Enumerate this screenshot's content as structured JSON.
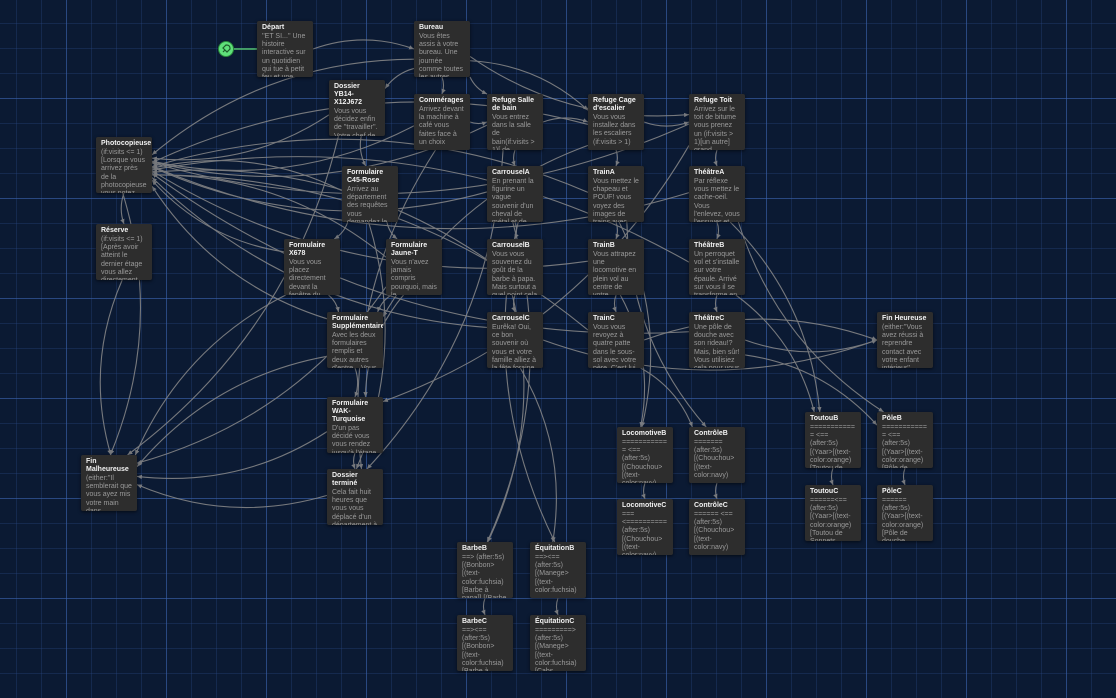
{
  "story": {
    "start_icon": "rocket-icon",
    "accent_color": "#5fe07a",
    "passages": [
      {
        "id": "depart",
        "title": "Départ",
        "excerpt": "''ET SI...'' Une histoire interactive sur un quotidien qui tue à petit feu et une"
      },
      {
        "id": "bureau",
        "title": "Bureau",
        "excerpt": "Vous êtes assis à votre bureau. Une journée comme toutes les autres s'ouvre"
      },
      {
        "id": "dossier",
        "title": "Dossier YB14-X12J672",
        "excerpt": "Vous vous décidez enfin de ''travailler''. Votre chef de département a"
      },
      {
        "id": "commerages",
        "title": "Commérages",
        "excerpt": "Arrivez devant la machine à café vous faites face à un choix"
      },
      {
        "id": "refuge_sdb",
        "title": "Refuge Salle de bain",
        "excerpt": "Vous entrez dans la salle de bain(if:visits > 1)[ de"
      },
      {
        "id": "refuge_cage",
        "title": "Refuge Cage d'escalier",
        "excerpt": "Vous vous installez dans les escaliers (if:visits > 1)"
      },
      {
        "id": "refuge_toit",
        "title": "Refuge Toit",
        "excerpt": "Arrivez sur le toit de bitume vous prenez un (if:visits > 1)[un autre] grand"
      },
      {
        "id": "photocopieuse",
        "title": "Photocopieuse",
        "excerpt": "(if:visits <= 1)[Lorsque vous arrivez près de la photocopieuse vous notez"
      },
      {
        "id": "reserve",
        "title": "Réserve",
        "excerpt": "(if:visits <= 1)[Après avoir atteint le dernier étage vous allez directement"
      },
      {
        "id": "c45",
        "title": "Formulaire C45-Rose",
        "excerpt": "Arrivez au département des requêtes vous demandez le"
      },
      {
        "id": "x678",
        "title": "Formulaire X678",
        "excerpt": "Vous vous placez directement devant la fenêtre du"
      },
      {
        "id": "jaune",
        "title": "Formulaire Jaune-T",
        "excerpt": "Vous n'avez jamais compris pourquoi, mais le département des requêtes"
      },
      {
        "id": "supp",
        "title": "Formulaire Supplémentaire",
        "excerpt": "Avec les deux formulaires remplis et deux autres d'entre... Vous"
      },
      {
        "id": "wak",
        "title": "Formulaire WAK-Turquoise",
        "excerpt": "D'un pas décidé vous vous rendez jusqu'à l'étage"
      },
      {
        "id": "termine",
        "title": "Dossier terminé",
        "excerpt": "Cela fait huit heures que vous vous déplacé d'un département à"
      },
      {
        "id": "malheureuse",
        "title": "Fin Malheureuse",
        "excerpt": "(either:''Il semblerait que vous ayez mis votre main dans"
      },
      {
        "id": "carA",
        "title": "CarrouselA",
        "excerpt": "En prenant la figurine un vague souvenir d'un cheval de métal et de plastique"
      },
      {
        "id": "carB",
        "title": "CarrouselB",
        "excerpt": "Vous vous souvenez du goût de la barbe à papa. Mais surtout a quel point cela"
      },
      {
        "id": "carC",
        "title": "CarrouselC",
        "excerpt": "Eurêka! Oui, ce bon souvenir où vous et votre famille alliez à la fête foraine"
      },
      {
        "id": "trainA",
        "title": "TrainA",
        "excerpt": "Vous mettez le chapeau et POUF! vous voyez des images de trains avec des"
      },
      {
        "id": "trainB",
        "title": "TrainB",
        "excerpt": "Vous attrapez une locomotive en plein vol au centre de votre rêvasserie. Puis soudainement"
      },
      {
        "id": "trainC",
        "title": "TrainC",
        "excerpt": "Vous vous revoyez à quatre patte dans le sous-sol avec votre père. C'est lui"
      },
      {
        "id": "theatreA",
        "title": "ThéâtreA",
        "excerpt": "Par réflexe vous mettez le cache-oeil. Vous l'enlevez, vous l'essuyer et vous le"
      },
      {
        "id": "theatreB",
        "title": "ThéâtreB",
        "excerpt": "Un perroquet vol et s'installe sur votre épaule. Arrivé sur vous il se transforme en"
      },
      {
        "id": "theatreC",
        "title": "ThéâtreC",
        "excerpt": "Une pôle de douche avec son rideau!? Mais, bien sûr! Vous utilisiez cela pour vous"
      },
      {
        "id": "finheureuse",
        "title": "Fin Heureuse",
        "excerpt": "(either:''Vous avez réussi à reprendre contact avec votre enfant intérieur''"
      },
      {
        "id": "locoB",
        "title": "LocomotiveB",
        "excerpt": "============ <== (after:5s) [(Chouchou> [(text-color:navy) [Chouchou Petit"
      },
      {
        "id": "locoC",
        "title": "LocomotiveC",
        "excerpt": "=== <========== (after:5s) [(Chouchou> [(text-color:navy)"
      },
      {
        "id": "ctrlB",
        "title": "ContrôleB",
        "excerpt": "======= (after:5s) [(Chouchou> [(text-color:navy)"
      },
      {
        "id": "ctrlC",
        "title": "ContrôleC",
        "excerpt": "====== <== (after:5s) [(Chouchou> [(text-color:navy)"
      },
      {
        "id": "toutouB",
        "title": "ToutouB",
        "excerpt": "============ <== (after:5s) [(Yaar>[(text-color:orange) [Toutou de Sonnets"
      },
      {
        "id": "toutouC",
        "title": "ToutouC",
        "excerpt": "======<== (after:5s) [(Yaar>[(text-color:orange) [Toutou de Sonnets"
      },
      {
        "id": "poleB",
        "title": "PôleB",
        "excerpt": "============ <== (after:5s) [(Yaar>[(text-color:orange) [Pôle de douche"
      },
      {
        "id": "poleC",
        "title": "PôleC",
        "excerpt": "====== (after:5s) [(Yaar>[(text-color:orange) [Pôle de douche"
      },
      {
        "id": "barbeB",
        "title": "BarbeB",
        "excerpt": "==> (after:5s) [(Bonbon> [(text-color:fuchsia) [Barbe à papa]] [(Barbe à"
      },
      {
        "id": "barbeC",
        "title": "BarbeC",
        "excerpt": "==><== (after:5s) [(Bonbon> [(text-color:fuchsia) [Barbe à papa]]"
      },
      {
        "id": "equiB",
        "title": "ÉquitationB",
        "excerpt": "==><== (after:5s) [(Manege> [(text-color:fuchsia)"
      },
      {
        "id": "equiC",
        "title": "ÉquitationC",
        "excerpt": "=========> (after:5s) [(Manege> [(text-color:fuchsia) [Cabs"
      }
    ]
  }
}
